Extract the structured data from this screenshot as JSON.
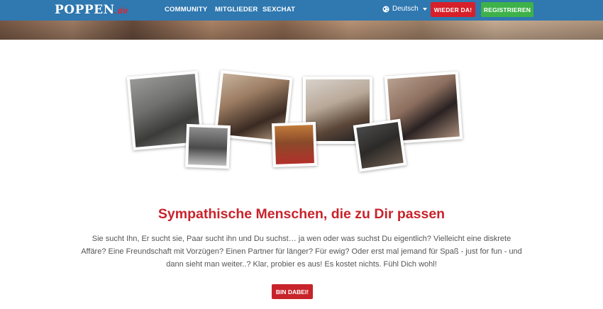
{
  "header": {
    "logo_main": "POPPEN",
    "logo_tld": ".de",
    "nav": [
      {
        "label": "COMMUNITY"
      },
      {
        "label": "MITGLIEDER"
      },
      {
        "label": "SEXCHAT"
      }
    ],
    "language": {
      "label": "Deutsch",
      "icon": "globe-icon"
    },
    "login_label": "WIEDER DA!",
    "register_label": "REGISTRIEREN"
  },
  "main": {
    "headline": "Sympathische Menschen, die zu Dir passen",
    "body": "Sie sucht Ihn, Er sucht sie, Paar sucht ihn und Du suchst… ja wen oder was suchst Du eigentlich? Vielleicht eine diskrete Affäre? Eine Freundschaft mit Vorzügen? Einen Partner für länger? Für ewig? Oder erst mal jemand für Spaß - just for fun - und dann sieht man weiter..? Klar, probier es aus! Es kostet nichts. Fühl Dich wohl!",
    "cta_label": "BIN DABEI!"
  },
  "colors": {
    "header_bg": "#2f78b0",
    "brand_red": "#c8232b",
    "register_green": "#3db24a"
  }
}
